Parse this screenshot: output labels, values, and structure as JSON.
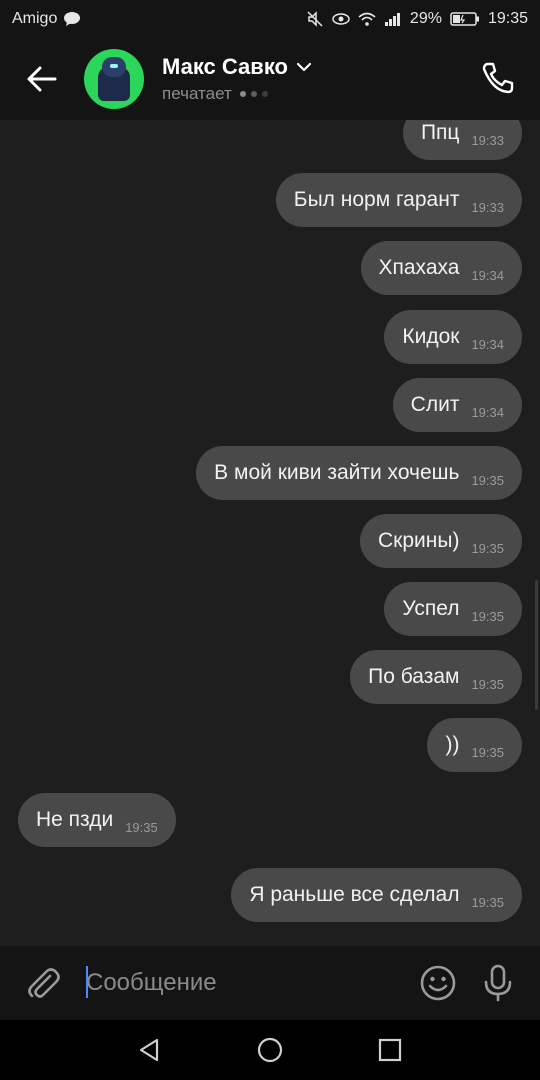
{
  "status_bar": {
    "carrier": "Amigo",
    "battery": "29%",
    "time": "19:35"
  },
  "header": {
    "contact_name": "Макс Савко",
    "contact_status": "печатает"
  },
  "messages": [
    {
      "text": "Ппц",
      "time": "19:33",
      "direction": "out"
    },
    {
      "text": "Был норм гарант",
      "time": "19:33",
      "direction": "out"
    },
    {
      "text": "Хпахаха",
      "time": "19:34",
      "direction": "out"
    },
    {
      "text": "Кидок",
      "time": "19:34",
      "direction": "out"
    },
    {
      "text": "Слит",
      "time": "19:34",
      "direction": "out"
    },
    {
      "text": "В мой киви зайти хочешь",
      "time": "19:35",
      "direction": "out"
    },
    {
      "text": "Скрины)",
      "time": "19:35",
      "direction": "out"
    },
    {
      "text": "Успел",
      "time": "19:35",
      "direction": "out"
    },
    {
      "text": "По базам",
      "time": "19:35",
      "direction": "out"
    },
    {
      "text": "))",
      "time": "19:35",
      "direction": "out"
    },
    {
      "text": "Не пзди",
      "time": "19:35",
      "direction": "in"
    },
    {
      "text": "Я раньше все сделал",
      "time": "19:35",
      "direction": "out"
    }
  ],
  "input": {
    "placeholder": "Сообщение",
    "value": ""
  },
  "icons": {
    "back": "arrow-left-icon",
    "call": "phone-icon",
    "attach": "paperclip-icon",
    "emoji": "smiley-icon",
    "mic": "microphone-icon",
    "nav_back": "triangle-back-icon",
    "nav_home": "circle-home-icon",
    "nav_recents": "square-recents-icon"
  },
  "colors": {
    "background": "#1e1e1e",
    "bubble": "#494949",
    "header": "#141414",
    "avatar_bg": "#2bd65a",
    "caret": "#4a8cff"
  }
}
